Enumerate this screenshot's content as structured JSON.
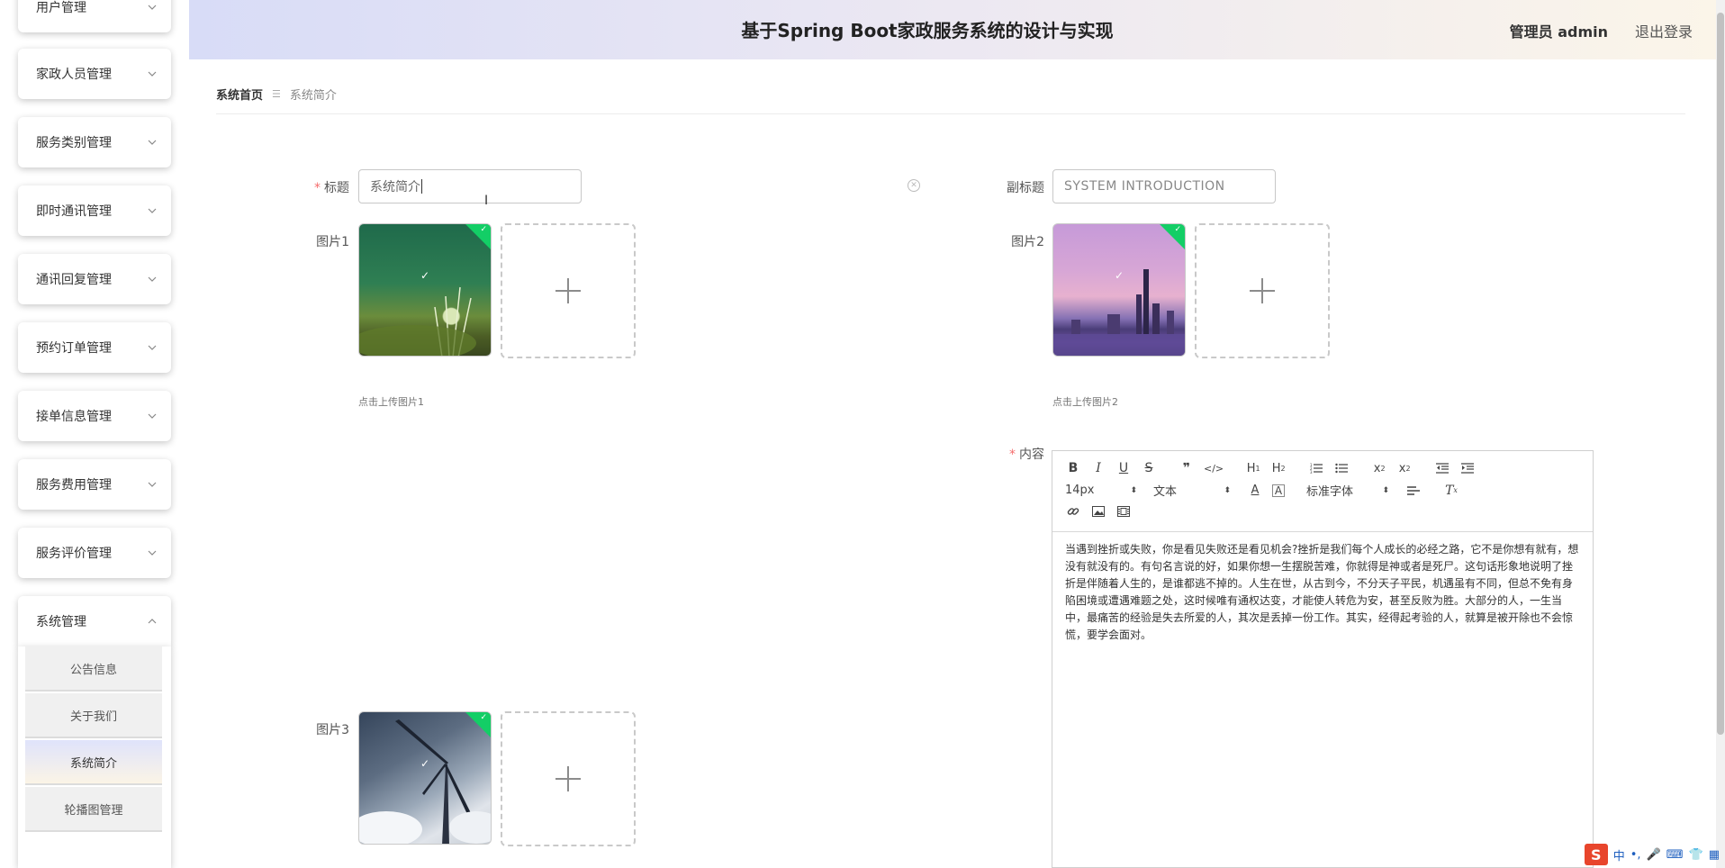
{
  "header": {
    "title": "基于Spring Boot家政服务系统的设计与实现",
    "user": "管理员 admin",
    "logout": "退出登录"
  },
  "sidebar": {
    "items": [
      {
        "label": "用户管理"
      },
      {
        "label": "家政人员管理"
      },
      {
        "label": "服务类别管理"
      },
      {
        "label": "即时通讯管理"
      },
      {
        "label": "通讯回复管理"
      },
      {
        "label": "预约订单管理"
      },
      {
        "label": "接单信息管理"
      },
      {
        "label": "服务费用管理"
      },
      {
        "label": "服务评价管理"
      },
      {
        "label": "系统管理"
      }
    ],
    "submenu": [
      {
        "label": "公告信息"
      },
      {
        "label": "关于我们"
      },
      {
        "label": "系统简介"
      },
      {
        "label": "轮播图管理"
      }
    ]
  },
  "breadcrumb": {
    "home": "系统首页",
    "current": "系统简介"
  },
  "form": {
    "title_label": "标题",
    "title_value": "系统简介",
    "subtitle_label": "副标题",
    "subtitle_value": "SYSTEM INTRODUCTION",
    "pic1_label": "图片1",
    "pic1_hint": "点击上传图片1",
    "pic2_label": "图片2",
    "pic2_hint": "点击上传图片2",
    "pic3_label": "图片3",
    "content_label": "内容"
  },
  "editor": {
    "font_size": "14px",
    "header_select": "文本",
    "font_family": "标准字体",
    "content": "当遇到挫折或失败，你是看见失败还是看见机会?挫折是我们每个人成长的必经之路，它不是你想有就有，想没有就没有的。有句名言说的好，如果你想一生摆脱苦难，你就得是神或者是死尸。这句话形象地说明了挫折是伴随着人生的，是谁都逃不掉的。人生在世，从古到今，不分天子平民，机遇虽有不同，但总不免有身陷困境或遭遇难题之处，这时候唯有通权达变，才能使人转危为安，甚至反败为胜。大部分的人，一生当中，最痛苦的经验是失去所爱的人，其次是丢掉一份工作。其实，经得起考验的人，就算是被开除也不会惊慌，要学会面对。"
  },
  "ime": {
    "mode": "中"
  }
}
